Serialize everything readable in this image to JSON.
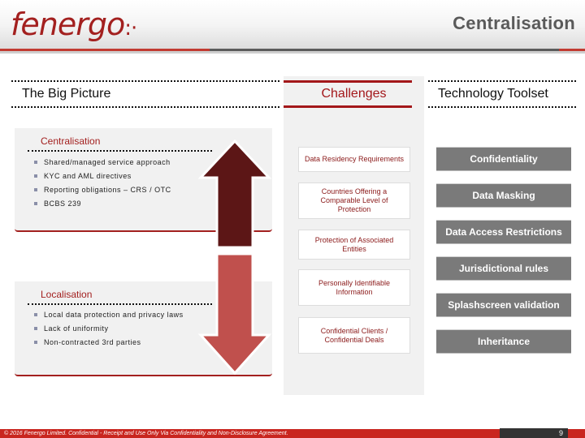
{
  "header": {
    "logo": "fenergo",
    "logo_mark": ":·",
    "title": "Centralisation"
  },
  "columns": {
    "big_picture": "The Big Picture",
    "challenges": "Challenges",
    "toolset": "Technology Toolset"
  },
  "centralisation": {
    "title": "Centralisation",
    "items": [
      "Shared/managed service approach",
      "KYC and AML directives",
      "Reporting obligations – CRS / OTC",
      "BCBS 239"
    ]
  },
  "localisation": {
    "title": "Localisation",
    "items": [
      "Local data protection and privacy laws",
      "Lack of uniformity",
      "Non-contracted 3rd parties"
    ]
  },
  "challenges": [
    "Data Residency Requirements",
    "Countries Offering a Comparable Level of Protection",
    "Protection of Associated Entities",
    "Personally Identifiable Information",
    "Confidential Clients / Confidential Deals"
  ],
  "toolset": [
    "Confidentiality",
    "Data Masking",
    "Data Access Restrictions",
    "Jurisdictional rules",
    "Splashscreen validation",
    "Inheritance"
  ],
  "colors": {
    "brand_red": "#a3201f",
    "arrow_up": "#5c1616",
    "arrow_down": "#c0504d",
    "tool_grey": "#7a7a7a"
  },
  "footer": {
    "text": "© 2016 Fenergo Limited. Confidential - Receipt and Use Only Via Confidentiality and Non-Disclosure Agreement.",
    "page": "9"
  }
}
